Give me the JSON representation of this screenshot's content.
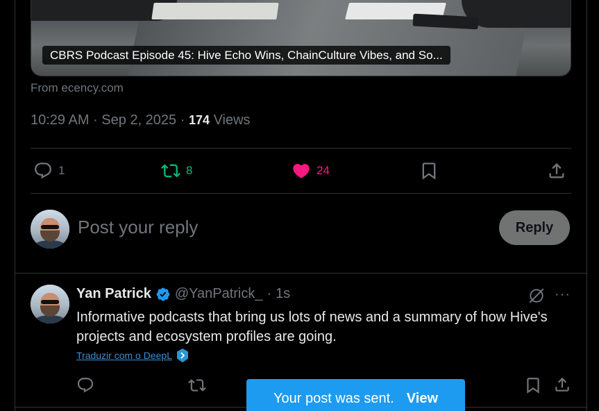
{
  "media": {
    "caption": "CBRS Podcast Episode 45: Hive Echo Wins, ChainCulture Vibes, and So...",
    "source": "From ecency.com"
  },
  "post_meta": {
    "time": "10:29 AM",
    "date": "Sep 2, 2025",
    "views_count": "174",
    "views_label": "Views"
  },
  "actions": {
    "replies": "1",
    "reposts": "8",
    "likes": "24",
    "repost_color": "#00ba7c",
    "like_color": "#f91880"
  },
  "compose": {
    "placeholder": "Post your reply",
    "button": "Reply"
  },
  "reply": {
    "name": "Yan Patrick",
    "handle": "@YanPatrick_",
    "time": "1s",
    "text": "Informative podcasts that bring us lots of news and a summary of how Hive's projects and ecosystem profiles are going.",
    "translate": "Traduzir com o DeepL"
  },
  "toast": {
    "message": "Your post was sent.",
    "action": "View"
  },
  "icons": [
    "reply-icon",
    "repost-icon",
    "like-icon",
    "bookmark-icon",
    "share-icon",
    "verified-icon",
    "grok-icon",
    "more-icon",
    "deepl-icon"
  ]
}
